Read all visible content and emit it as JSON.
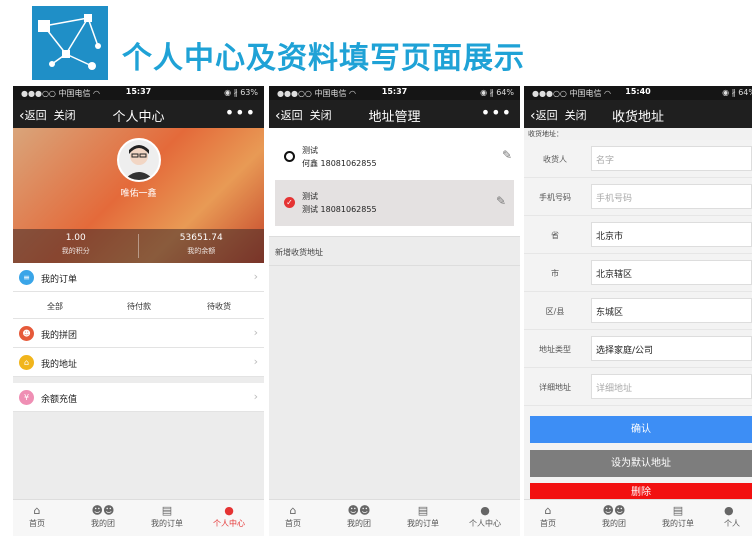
{
  "header": {
    "title": "个人中心及资料填写页面展示"
  },
  "status": {
    "carrier": "●●●○○ 中国电信 ",
    "wifi": "◠",
    "t1": "15:37",
    "t2": "15:37",
    "t3": "15:40",
    "r1": "◉ ∦ 63%",
    "r2": "◉ ∦ 64%",
    "r3": "◉ ∦ 64%"
  },
  "nav": {
    "back": "返回",
    "close": "关闭",
    "more": "•••"
  },
  "p1": {
    "title": "个人中心",
    "username": "唯佑一鑫",
    "points_value": "1.00",
    "points_label": "我的积分",
    "balance_value": "53651.74",
    "balance_label": "我的余额",
    "orders": "我的订单",
    "sub_all": "全部",
    "sub_unpaid": "待付款",
    "sub_receive": "待收货",
    "group": "我的拼团",
    "address": "我的地址",
    "recharge": "余额充值"
  },
  "p2": {
    "title": "地址管理",
    "a1_name": "测试",
    "a1_detail": "何鑫   18081062855",
    "a2_name": "测试",
    "a2_detail": "测试   18081062855",
    "new_address": "新增收货地址"
  },
  "p3": {
    "title": "收货地址",
    "form_title": "收货地址：",
    "name_label": "收货人",
    "name_ph": "名字",
    "phone_label": "手机号码",
    "phone_ph": "手机号码",
    "province_label": "省",
    "province_val": "北京市",
    "city_label": "市",
    "city_val": "北京辖区",
    "district_label": "区/县",
    "district_val": "东城区",
    "type_label": "地址类型",
    "type_val": "选择家庭/公司",
    "detail_label": "详细地址",
    "detail_ph": "详细地址",
    "confirm": "确认",
    "set_default": "设为默认地址",
    "delete": "删除"
  },
  "tabs": {
    "home": "首页",
    "group": "我的团",
    "orders": "我的订单",
    "me": "个人中心",
    "me_short": "个人"
  },
  "colors": {
    "accent": "#e53333",
    "blue": "#3d8ef5",
    "title": "#1fa2d6"
  }
}
